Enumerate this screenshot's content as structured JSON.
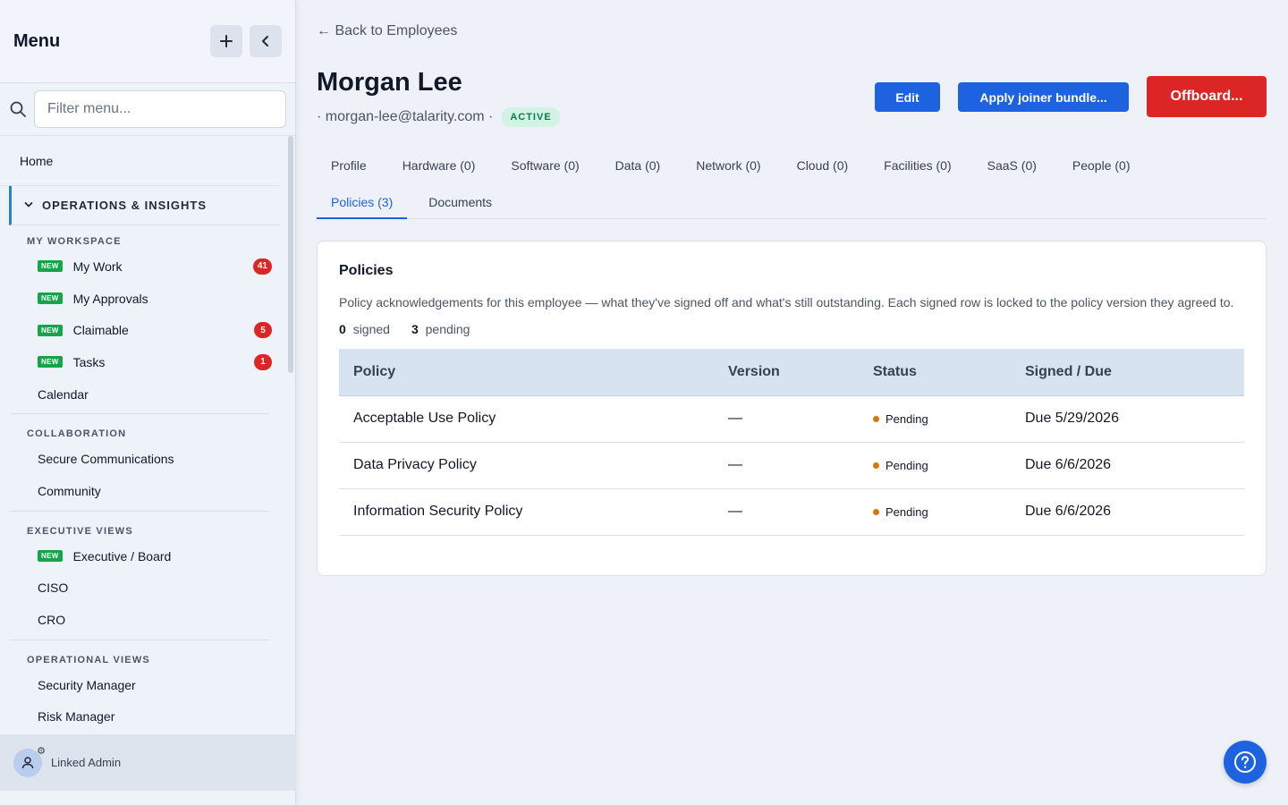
{
  "sidebar": {
    "title": "Menu",
    "filter_placeholder": "Filter menu...",
    "home": "Home",
    "group": "OPERATIONS & INSIGHTS",
    "sections": {
      "workspace": "MY WORKSPACE",
      "collaboration": "COLLABORATION",
      "executive": "EXECUTIVE VIEWS",
      "operational": "OPERATIONAL VIEWS"
    },
    "new_tag": "NEW",
    "items": {
      "my_work": {
        "label": "My Work",
        "count": "41"
      },
      "my_approvals": {
        "label": "My Approvals"
      },
      "claimable": {
        "label": "Claimable",
        "count": "5"
      },
      "tasks": {
        "label": "Tasks",
        "count": "1"
      },
      "calendar": {
        "label": "Calendar"
      },
      "secure_comms": {
        "label": "Secure Communications"
      },
      "community": {
        "label": "Community"
      },
      "exec_board": {
        "label": "Executive / Board"
      },
      "ciso": {
        "label": "CISO"
      },
      "cro": {
        "label": "CRO"
      },
      "security_manager": {
        "label": "Security Manager"
      },
      "risk_manager": {
        "label": "Risk Manager"
      }
    },
    "footer_user": "Linked Admin"
  },
  "header": {
    "back_link": "← Back to Employees",
    "name": "Morgan Lee",
    "email": "· morgan-lee@talarity.com ·",
    "status_badge": "ACTIVE",
    "edit_label": "Edit",
    "apply_label": "Apply joiner bundle...",
    "offboard_label": "Offboard..."
  },
  "tabs": [
    "Profile",
    "Hardware (0)",
    "Software (0)",
    "Data (0)",
    "Network (0)",
    "Cloud (0)",
    "Facilities (0)",
    "SaaS (0)",
    "People (0)",
    "Policies (3)",
    "Documents"
  ],
  "selected_tab": "Policies (3)",
  "policies": {
    "title": "Policies",
    "description": "Policy acknowledgements for this employee — what they've signed off and what's still outstanding. Each signed row is locked to the policy version they agreed to.",
    "signed_count": "0",
    "signed_label": "signed",
    "pending_count": "3",
    "pending_label": "pending",
    "columns": [
      "Policy",
      "Version",
      "Status",
      "Signed / Due"
    ],
    "rows": [
      {
        "policy": "Acceptable Use Policy",
        "version": "—",
        "status": "Pending",
        "due": "Due 5/29/2026"
      },
      {
        "policy": "Data Privacy Policy",
        "version": "—",
        "status": "Pending",
        "due": "Due 6/6/2026"
      },
      {
        "policy": "Information Security Policy",
        "version": "—",
        "status": "Pending",
        "due": "Due 6/6/2026"
      }
    ]
  },
  "colors": {
    "primary": "#1d63e0",
    "danger": "#dc2626",
    "success": "#16a34a",
    "pending": "#d97706"
  }
}
